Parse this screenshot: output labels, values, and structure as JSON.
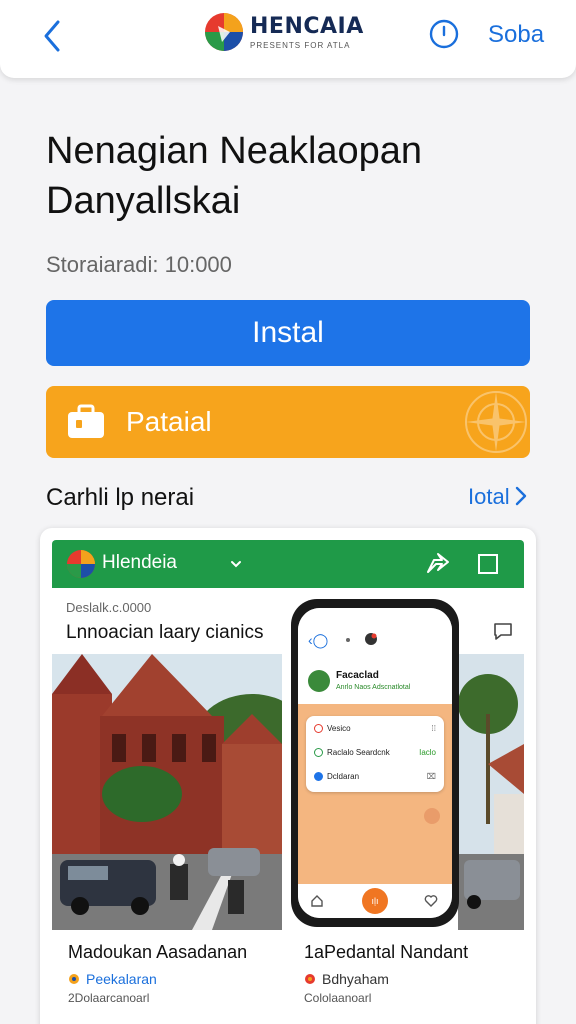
{
  "header": {
    "brand": "HENCAIA",
    "tagline": "PRESENTS FOR ATLA",
    "right_link": "Soba"
  },
  "app": {
    "title": "Nenagian Neaklaopan Danyallskai",
    "meta": "Storaiaradi: 10:000",
    "install_label": "Instal",
    "portal_label": "Pataial"
  },
  "section": {
    "title": "Carhli lp nerai",
    "link": "Iotal"
  },
  "preview": {
    "bar_name": "Hlendeia",
    "meta": "Deslalk.c.0000",
    "title": "Lnnoacian laary cianics",
    "phone": {
      "profile_name": "Facaclad",
      "profile_sub": "Anrlo Naos Adscnatlotal",
      "rows": [
        {
          "label": "Vesico",
          "right": "⁞⁞"
        },
        {
          "label": "Raclalo Seardcnk",
          "right": "Iaclo"
        },
        {
          "label": "Dcldaran",
          "right": "⌧"
        }
      ],
      "fab_label": "ıļı"
    },
    "captions": [
      {
        "title": "Madoukan Aasadanan",
        "badge": "Peekalaran",
        "meta": "2Dolaarcanoarl"
      },
      {
        "title": "1aPedantal Nandant",
        "badge": "Bdhyaham",
        "meta": "Cololaanoarl"
      }
    ]
  },
  "colors": {
    "accent_blue": "#1e74e8",
    "accent_orange": "#f7a41c",
    "bar_green": "#1f9a48",
    "brand_navy": "#152a55"
  },
  "icons": [
    "back-chevron-icon",
    "power-icon",
    "briefcase-icon",
    "chevron-right-icon",
    "share-icon",
    "square-icon",
    "menu-icon",
    "heart-icon",
    "home-icon"
  ]
}
